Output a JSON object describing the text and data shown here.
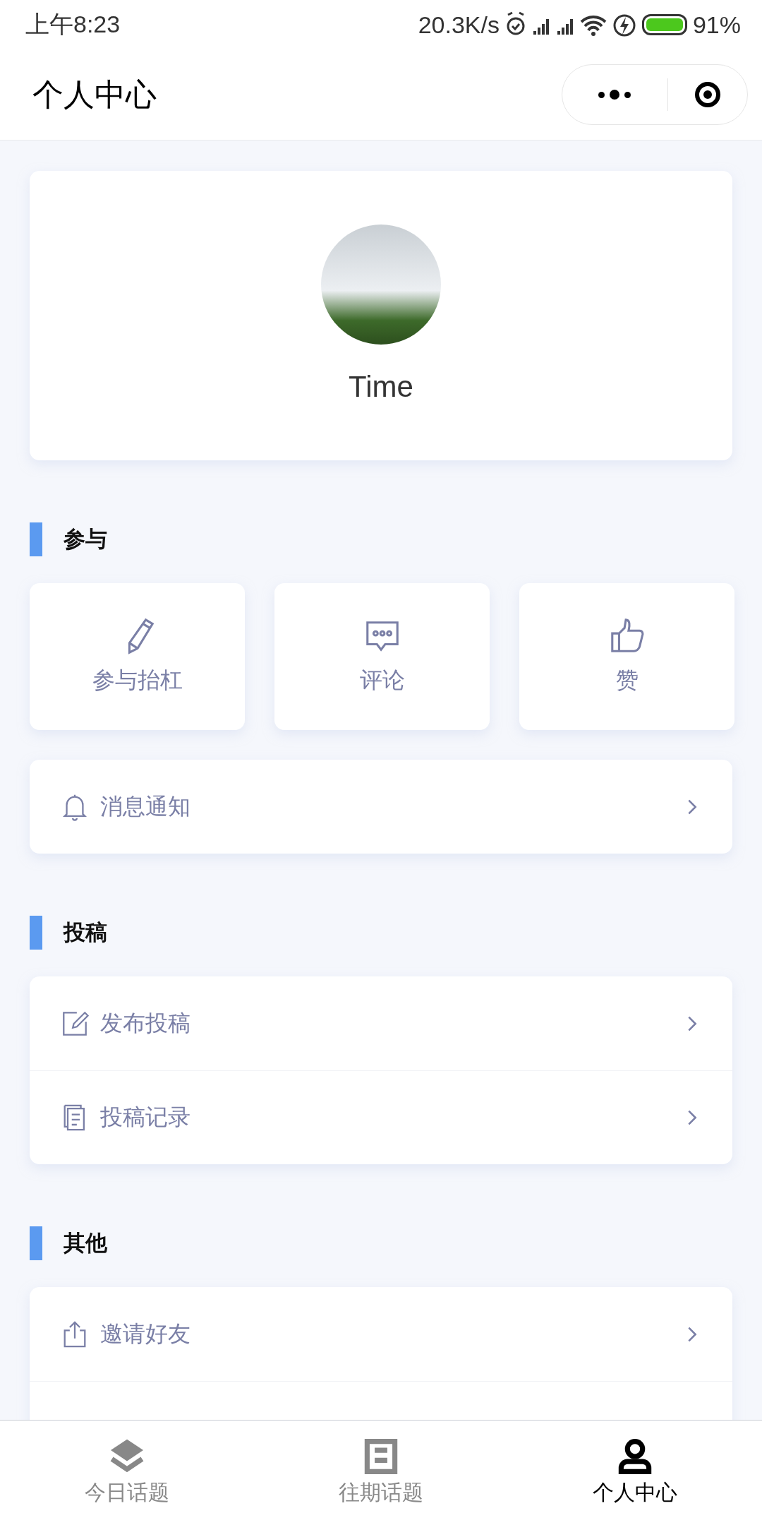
{
  "status_bar": {
    "time": "上午8:23",
    "speed": "20.3K/s",
    "battery": "91%"
  },
  "nav_bar": {
    "title": "个人中心"
  },
  "profile": {
    "name": "Time"
  },
  "sections": [
    {
      "title": "参与",
      "kind": "grid",
      "items": [
        {
          "label": "参与抬杠"
        },
        {
          "label": "评论"
        },
        {
          "label": "赞"
        }
      ],
      "rows": [
        {
          "label": "消息通知"
        }
      ]
    },
    {
      "title": "投稿",
      "kind": "list",
      "rows": [
        {
          "label": "发布投稿"
        },
        {
          "label": "投稿记录"
        }
      ]
    },
    {
      "title": "其他",
      "kind": "list",
      "rows": [
        {
          "label": "邀请好友"
        }
      ]
    }
  ],
  "tabs": [
    {
      "label": "今日话题",
      "selected": false
    },
    {
      "label": "往期话题",
      "selected": false
    },
    {
      "label": "个人中心",
      "selected": true
    }
  ]
}
